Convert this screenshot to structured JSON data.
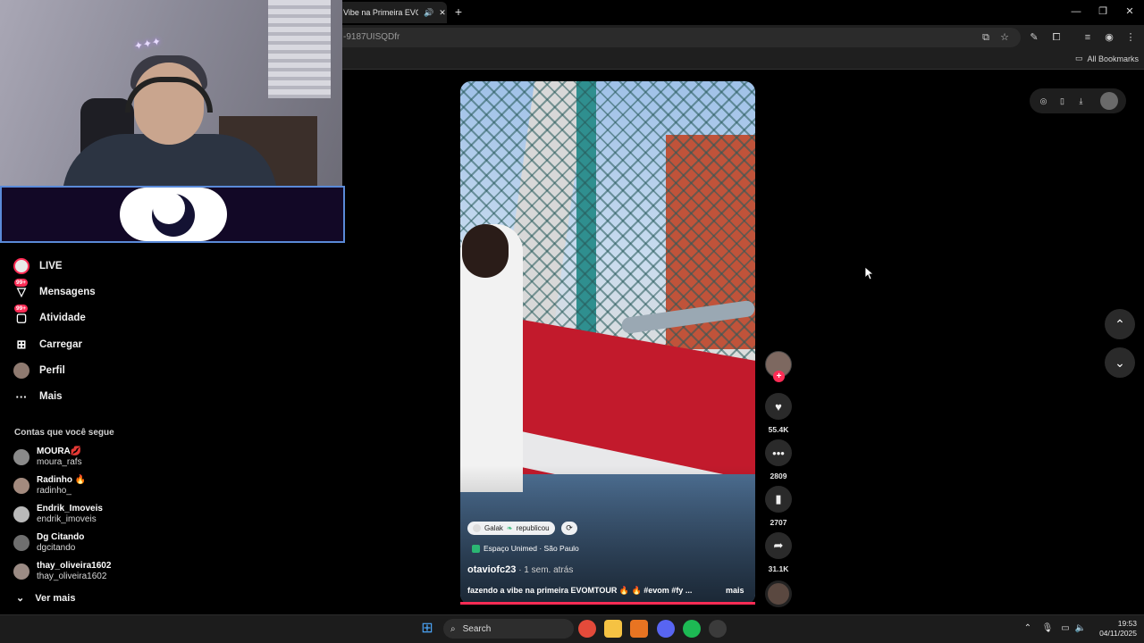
{
  "browser": {
    "tab_title": "Vibe na Primeira EVOM",
    "tab_audio_icon": "speaker-icon",
    "new_tab": "+",
    "url": "-9187UISQDfr",
    "all_bookmarks": "All Bookmarks",
    "window_controls": [
      "—",
      "❐",
      "✕"
    ]
  },
  "sidebar": {
    "items": [
      {
        "label": "LIVE",
        "icon": "live-avatar-icon"
      },
      {
        "label": "Mensagens",
        "icon": "message-icon",
        "badge": "99+"
      },
      {
        "label": "Atividade",
        "icon": "inbox-icon",
        "badge": "99+"
      },
      {
        "label": "Carregar",
        "icon": "upload-icon"
      },
      {
        "label": "Perfil",
        "icon": "profile-avatar-icon"
      },
      {
        "label": "Mais",
        "icon": "more-icon"
      }
    ],
    "following_title": "Contas que você segue",
    "accounts": [
      {
        "name": "MOURA💋",
        "handle": "moura_rafs"
      },
      {
        "name": "Radinho 🔥",
        "handle": "radinho_"
      },
      {
        "name": "Endrik_Imoveis",
        "handle": "endrik_imoveis"
      },
      {
        "name": "Dg Citando",
        "handle": "dgcitando"
      },
      {
        "name": "thay_oliveira1602",
        "handle": "thay_oliveira1602"
      }
    ],
    "see_more": "Ver mais"
  },
  "video": {
    "repost_user": "Galak",
    "repost_text": "republicou",
    "location": "Espaço Unimed · São Paulo",
    "author": "otaviofc23",
    "time_ago": " · 1 sem. atrás",
    "caption": "fazendo a vibe na primeira EVOMTOUR 🔥 🔥 #evom #fy ...",
    "more": "mais"
  },
  "actions": {
    "likes": "55.4K",
    "comments": "2809",
    "saves": "2707",
    "shares": "31.1K"
  },
  "taskbar": {
    "search": "Search",
    "time": "19:53",
    "date": "04/11/2025"
  },
  "colors": {
    "accent": "#fe2c55",
    "banner_border": "#5a8ad8"
  }
}
